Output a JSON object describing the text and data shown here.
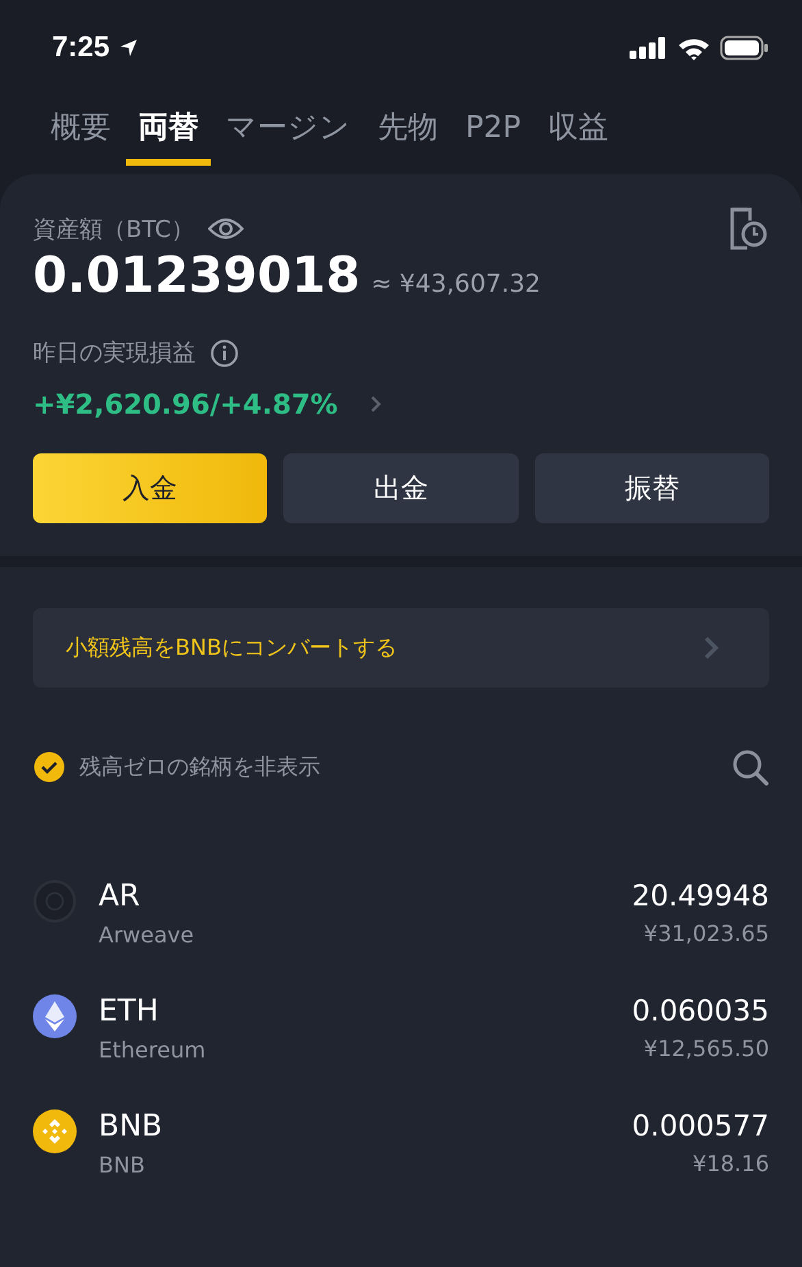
{
  "status_bar": {
    "time": "7:25"
  },
  "tabs": [
    {
      "label": "概要",
      "selected": false
    },
    {
      "label": "両替",
      "selected": true
    },
    {
      "label": "マージン",
      "selected": false
    },
    {
      "label": "先物",
      "selected": false
    },
    {
      "label": "P2P",
      "selected": false
    },
    {
      "label": "収益",
      "selected": false
    }
  ],
  "balance": {
    "label": "資産額（BTC）",
    "amount": "0.01239018",
    "fiat": "≈ ¥43,607.32",
    "pnl_label": "昨日の実現損益",
    "pnl": "+¥2,620.96/+4.87%"
  },
  "buttons": [
    {
      "label": "入金",
      "kind": "primary"
    },
    {
      "label": "出金",
      "kind": "secondary"
    },
    {
      "label": "振替",
      "kind": "secondary"
    }
  ],
  "convert_banner": "小額残高をBNBにコンバートする",
  "hide_zero": {
    "label": "残高ゼロの銘柄を非表示",
    "checked": true
  },
  "assets": [
    {
      "kind": "ar",
      "symbol": "AR",
      "name": "Arweave",
      "amount": "20.49948",
      "fiat": "¥31,023.65"
    },
    {
      "kind": "eth",
      "symbol": "ETH",
      "name": "Ethereum",
      "amount": "0.060035",
      "fiat": "¥12,565.50"
    },
    {
      "kind": "bnb",
      "symbol": "BNB",
      "name": "BNB",
      "amount": "0.000577",
      "fiat": "¥18.16"
    }
  ]
}
